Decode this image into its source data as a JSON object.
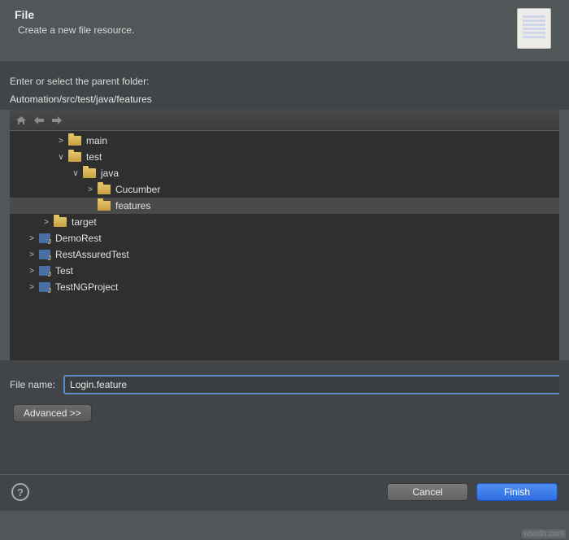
{
  "header": {
    "title": "File",
    "subtitle": "Create a new file resource."
  },
  "parent_folder": {
    "label": "Enter or select the parent folder:",
    "path": "Automation/src/test/java/features"
  },
  "tree": {
    "items": [
      {
        "indent": 3,
        "twisty": ">",
        "icon": "folder",
        "label": "main",
        "selected": false
      },
      {
        "indent": 3,
        "twisty": "∨",
        "icon": "folder",
        "label": "test",
        "selected": false
      },
      {
        "indent": 4,
        "twisty": "∨",
        "icon": "folder",
        "label": "java",
        "selected": false
      },
      {
        "indent": 5,
        "twisty": ">",
        "icon": "folder",
        "label": "Cucumber",
        "selected": false
      },
      {
        "indent": 5,
        "twisty": "",
        "icon": "folder",
        "label": "features",
        "selected": true
      },
      {
        "indent": 2,
        "twisty": ">",
        "icon": "folder",
        "label": "target",
        "selected": false
      },
      {
        "indent": 1,
        "twisty": ">",
        "icon": "proj",
        "label": "DemoRest",
        "selected": false
      },
      {
        "indent": 1,
        "twisty": ">",
        "icon": "proj",
        "label": "RestAssuredTest",
        "selected": false
      },
      {
        "indent": 1,
        "twisty": ">",
        "icon": "proj",
        "label": "Test",
        "selected": false
      },
      {
        "indent": 1,
        "twisty": ">",
        "icon": "proj",
        "label": "TestNGProject",
        "selected": false
      }
    ]
  },
  "filename": {
    "label": "File name:",
    "value": "Login.feature"
  },
  "buttons": {
    "advanced": "Advanced >>",
    "cancel": "Cancel",
    "finish": "Finish"
  },
  "watermark": "wsxdn.com"
}
